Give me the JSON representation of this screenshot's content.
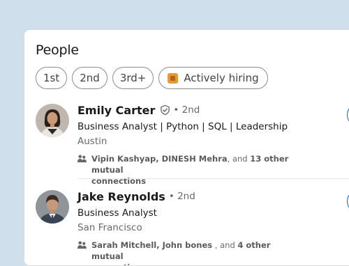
{
  "section": {
    "title": "People"
  },
  "filters": [
    {
      "label": "1st"
    },
    {
      "label": "2nd"
    },
    {
      "label": "3rd+"
    },
    {
      "label": "Actively hiring",
      "icon": "briefcase-icon"
    }
  ],
  "people": [
    {
      "name": "Emily Carter",
      "verified": true,
      "degree": "• 2nd",
      "headline": "Business Analyst | Python | SQL | Leadership",
      "location": "Austin",
      "mutual": {
        "names": "Vipin Kashyap, DINESH Mehra",
        "sep": ", and ",
        "count": "13 other mutual",
        "tail": "connections"
      }
    },
    {
      "name": "Jake Reynolds",
      "verified": false,
      "degree": "• 2nd",
      "headline": "Business Analyst",
      "location": "San Francisco",
      "mutual": {
        "names": "Sarah Mitchell, John bones",
        "sep": " , and ",
        "count": "4 other mutual",
        "tail": "connections"
      }
    }
  ],
  "colors": {
    "accent": "#0a66c2",
    "page_bg": "#cfdfec",
    "hiring": "#e39b3a"
  }
}
